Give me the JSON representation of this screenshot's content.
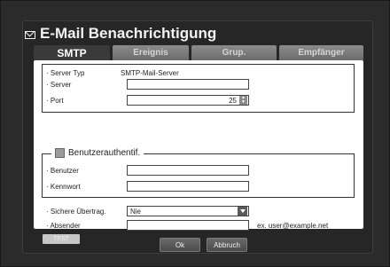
{
  "dialog": {
    "title": "E-Mail Benachrichtigung"
  },
  "tabs": [
    {
      "label": "SMTP",
      "active": true
    },
    {
      "label": "Ereignis",
      "active": false
    },
    {
      "label": "Grup.",
      "active": false
    },
    {
      "label": "Empfänger",
      "active": false
    }
  ],
  "server_section": {
    "server_type_label": "· Server Typ",
    "server_type_value": "SMTP-Mail-Server",
    "server_label": "· Server",
    "server_value": "",
    "port_label": "· Port",
    "port_value": "25"
  },
  "auth_section": {
    "legend": "Benutzerauthentif.",
    "checked": false,
    "user_label": "· Benutzer",
    "user_value": "",
    "password_label": "· Kennwort",
    "password_value": ""
  },
  "transfer_section": {
    "secure_label": "· Sichere Übertrag.",
    "secure_value": "Nie",
    "sender_label": "· Absender",
    "sender_value": "",
    "sender_hint": "ex. user@example.net",
    "test_label": "TEST"
  },
  "footer": {
    "ok_label": "Ok",
    "cancel_label": "Abbruch"
  },
  "colors": {
    "background": "#2b2b2b",
    "tab_inactive": "#7a7a7a",
    "panel": "#ffffff"
  },
  "icons": {
    "title_icon": "mail-icon",
    "spinner": "spinner-arrows-icon",
    "dropdown": "chevron-down-icon"
  }
}
